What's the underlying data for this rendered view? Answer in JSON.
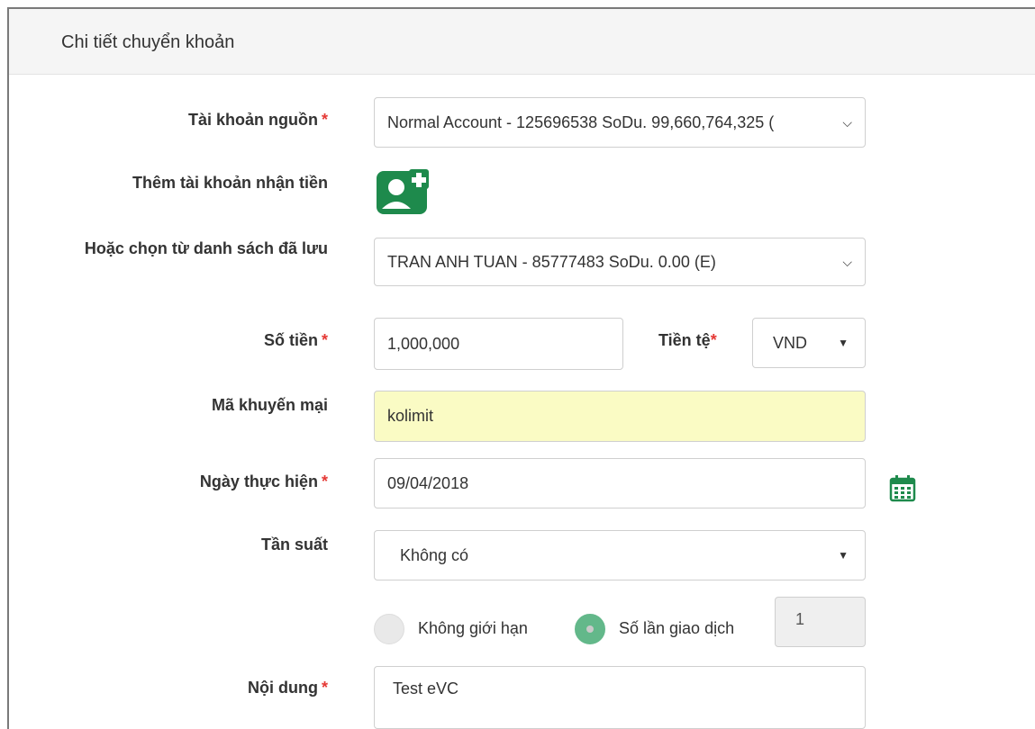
{
  "panel": {
    "title": "Chi tiết chuyển khoản"
  },
  "form": {
    "source_account": {
      "label": "Tài khoản nguồn",
      "required_mark": "*",
      "value": "Normal Account - 125696538 SoDu. 99,660,764,325 ("
    },
    "add_recipient": {
      "label": "Thêm tài khoản nhận tiền",
      "icon": "add-user-icon"
    },
    "saved_list": {
      "label": "Hoặc chọn từ danh sách đã lưu",
      "value": "TRAN ANH TUAN - 85777483 SoDu. 0.00 (E)"
    },
    "amount": {
      "label": "Số tiền",
      "required_mark": "*",
      "value": "1,000,000"
    },
    "currency": {
      "label": "Tiền tệ",
      "required_mark": "*",
      "value": "VND"
    },
    "promo": {
      "label": "Mã khuyến mại",
      "value": "kolimit"
    },
    "date": {
      "label": "Ngày thực hiện",
      "required_mark": "*",
      "value": "09/04/2018",
      "icon": "calendar-icon"
    },
    "frequency": {
      "label": "Tần suất",
      "value": "Không có"
    },
    "limit_options": {
      "unlimited_label": "Không giới hạn",
      "count_label": "Số lần giao dịch",
      "count_value": "1",
      "selected": "count"
    },
    "content": {
      "label": "Nội dung",
      "required_mark": "*",
      "value": "Test eVC"
    }
  },
  "colors": {
    "required": "#e53935",
    "icon_green": "#1e8a4c",
    "promo_bg": "#fafbc4"
  }
}
